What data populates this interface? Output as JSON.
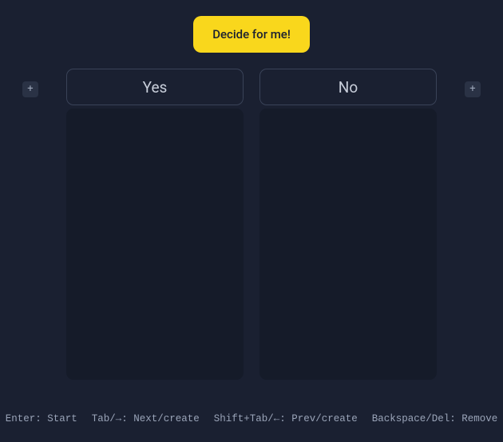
{
  "top": {
    "decide_label": "Decide for me!"
  },
  "columns": {
    "add_left_label": "+",
    "add_right_label": "+",
    "items": [
      {
        "title": "Yes"
      },
      {
        "title": "No"
      }
    ]
  },
  "hints": {
    "enter": "Enter: Start",
    "tab": "Tab/→: Next/create",
    "shift_tab": "Shift+Tab/←: Prev/create",
    "backspace": "Backspace/Del: Remove"
  }
}
